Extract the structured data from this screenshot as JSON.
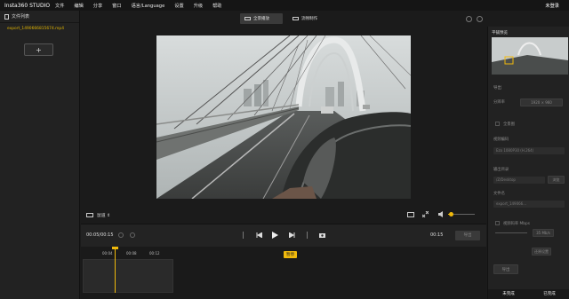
{
  "app": {
    "title": "Insta360 STUDIO",
    "menu": [
      "文件",
      "编辑",
      "分享",
      "窗口",
      "语言/Language",
      "设置",
      "升级",
      "帮助"
    ],
    "login_label": "未登录"
  },
  "sidebar": {
    "header": "文件列表",
    "files": [
      "export_1490666815674.mp4"
    ],
    "add_label": "+"
  },
  "mode_tabs": [
    {
      "label": "全景播放",
      "active": true
    },
    {
      "label": "流畅制作",
      "active": false
    }
  ],
  "controls": {
    "view_mode": "鼠道 ⇕",
    "current_time": "00:05/00:15",
    "end_time": "00:15",
    "export_label": "导出",
    "tooltip": "暂停"
  },
  "timeline": {
    "ticks": [
      "00:04",
      "00:08",
      "00:12"
    ]
  },
  "right_panel": {
    "title": "平铺预览",
    "section_title": "导出",
    "resolution_label": "分辨率",
    "resolution_value": "1920 × 960",
    "stabilize_label": "全景图",
    "codec_label": "视频编码",
    "codec_value": "Ezo 1080P30 (H.264)",
    "output_label": "输出目录",
    "output_value": "/Z/Desktop",
    "browse_label": "浏览",
    "filename_label": "文件名",
    "filename_value": "export_149066...",
    "quality_label": "视频码率 Mbps",
    "quality_value": "35 Mb/s",
    "reset_label": "还原设置",
    "export_button": "导出",
    "bottom_tabs": [
      "未完成",
      "已完成"
    ]
  },
  "colors": {
    "accent": "#f0b90b",
    "background": "#1b1b1b",
    "panel": "#222222"
  }
}
